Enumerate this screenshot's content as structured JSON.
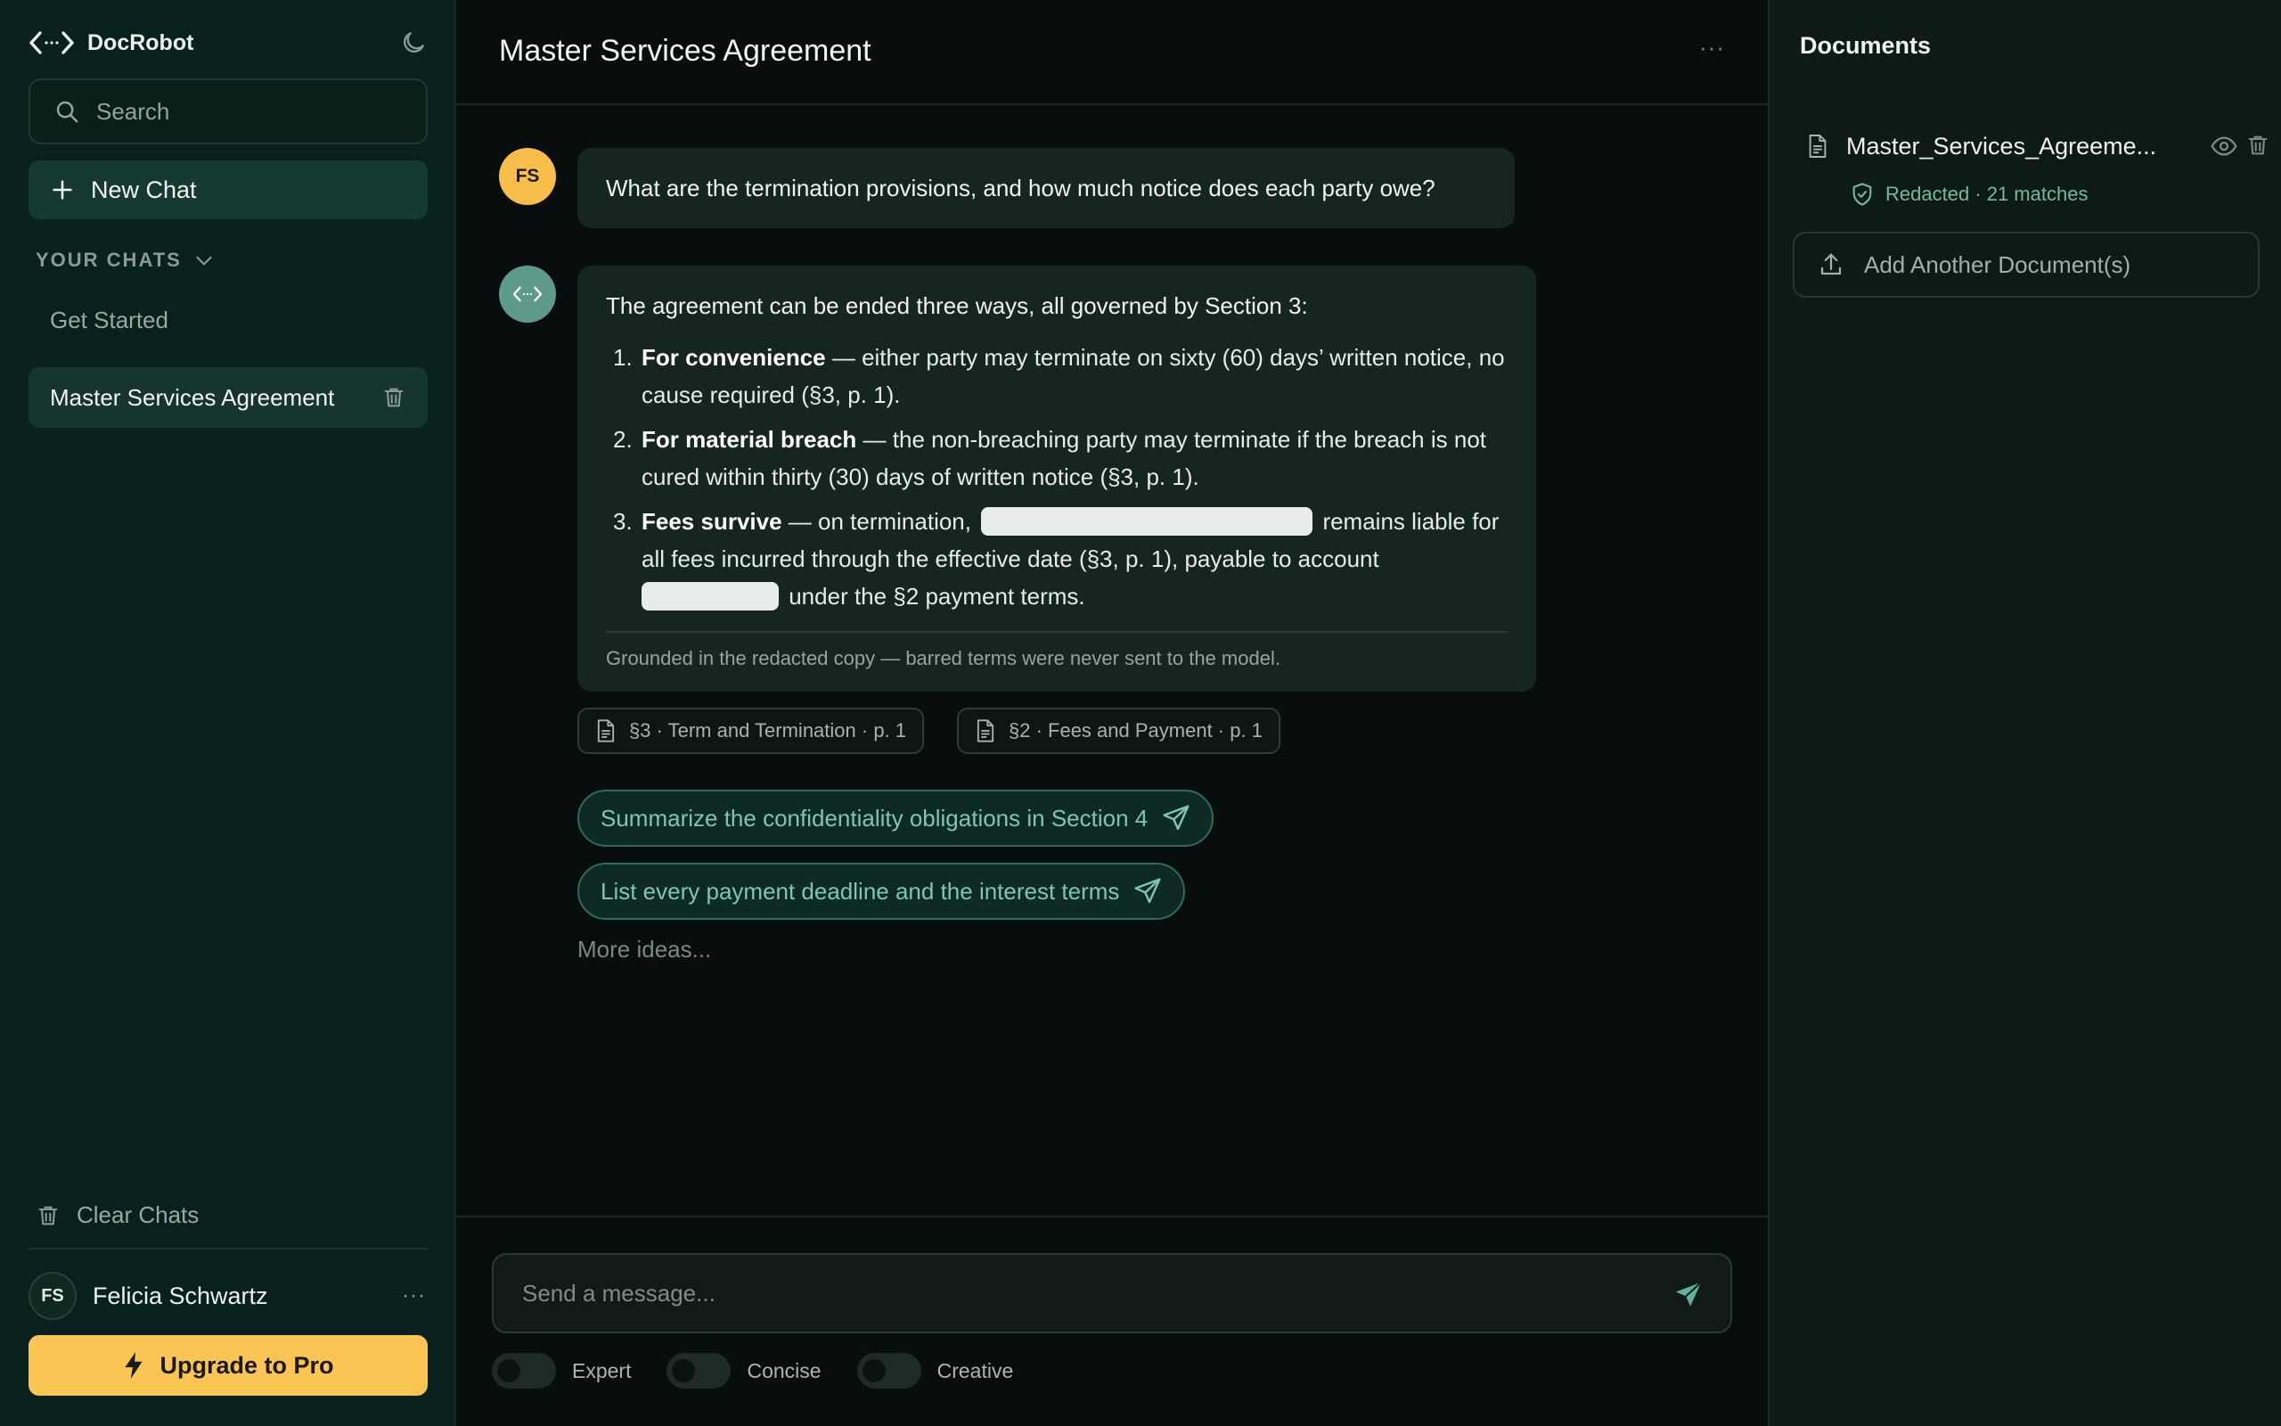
{
  "app": {
    "name": "DocRobot"
  },
  "sidebar": {
    "search_placeholder": "Search",
    "new_chat": "New Chat",
    "section_label": "YOUR CHATS",
    "chats": [
      "Get Started",
      "Master Services Agreement"
    ],
    "clear_chats": "Clear Chats",
    "user": {
      "initials": "FS",
      "name": "Felicia Schwartz"
    },
    "upgrade": "Upgrade to Pro"
  },
  "main": {
    "title": "Master Services Agreement",
    "user_initials": "FS",
    "question": "What are the termination provisions, and how much notice does each party owe?",
    "answer": {
      "intro": "The agreement can be ended three ways, all governed by Section 3:",
      "items": [
        {
          "num": "1.",
          "bold": "For convenience",
          "text": " — either party may terminate on sixty (60) days’ written notice, no cause required (§3, p. 1)."
        },
        {
          "num": "2.",
          "bold": "For material breach",
          "text": " — the non-breaching party may terminate if the breach is not cured within thirty (30) days of written notice (§3, p. 1)."
        },
        {
          "num": "3.",
          "bold": "Fees survive",
          "text_a": " — on termination, ",
          "text_b": " remains liable for all fees incurred through the effective date (§3, p. 1), payable to account ",
          "text_c": " under the §2 payment terms."
        }
      ],
      "footnote": "Grounded in the redacted copy — barred terms were never sent to the model."
    },
    "sources": [
      "§3 · Term and Termination · p. 1",
      "§2 · Fees and Payment · p. 1"
    ],
    "suggestions": [
      "Summarize the confidentiality obligations in Section 4",
      "List every payment deadline and the interest terms"
    ],
    "more_ideas": "More ideas...",
    "composer_placeholder": "Send a message...",
    "toggles": [
      "Expert",
      "Concise",
      "Creative"
    ]
  },
  "documents": {
    "title": "Documents",
    "file_name": "Master_Services_Agreeme...",
    "status": "Redacted · 21 matches",
    "add_button": "Add Another Document(s)"
  },
  "colors": {
    "accent": "#fac553",
    "brand_teal": "#5d9a8c",
    "suggestion_text": "#7fc6b1"
  }
}
